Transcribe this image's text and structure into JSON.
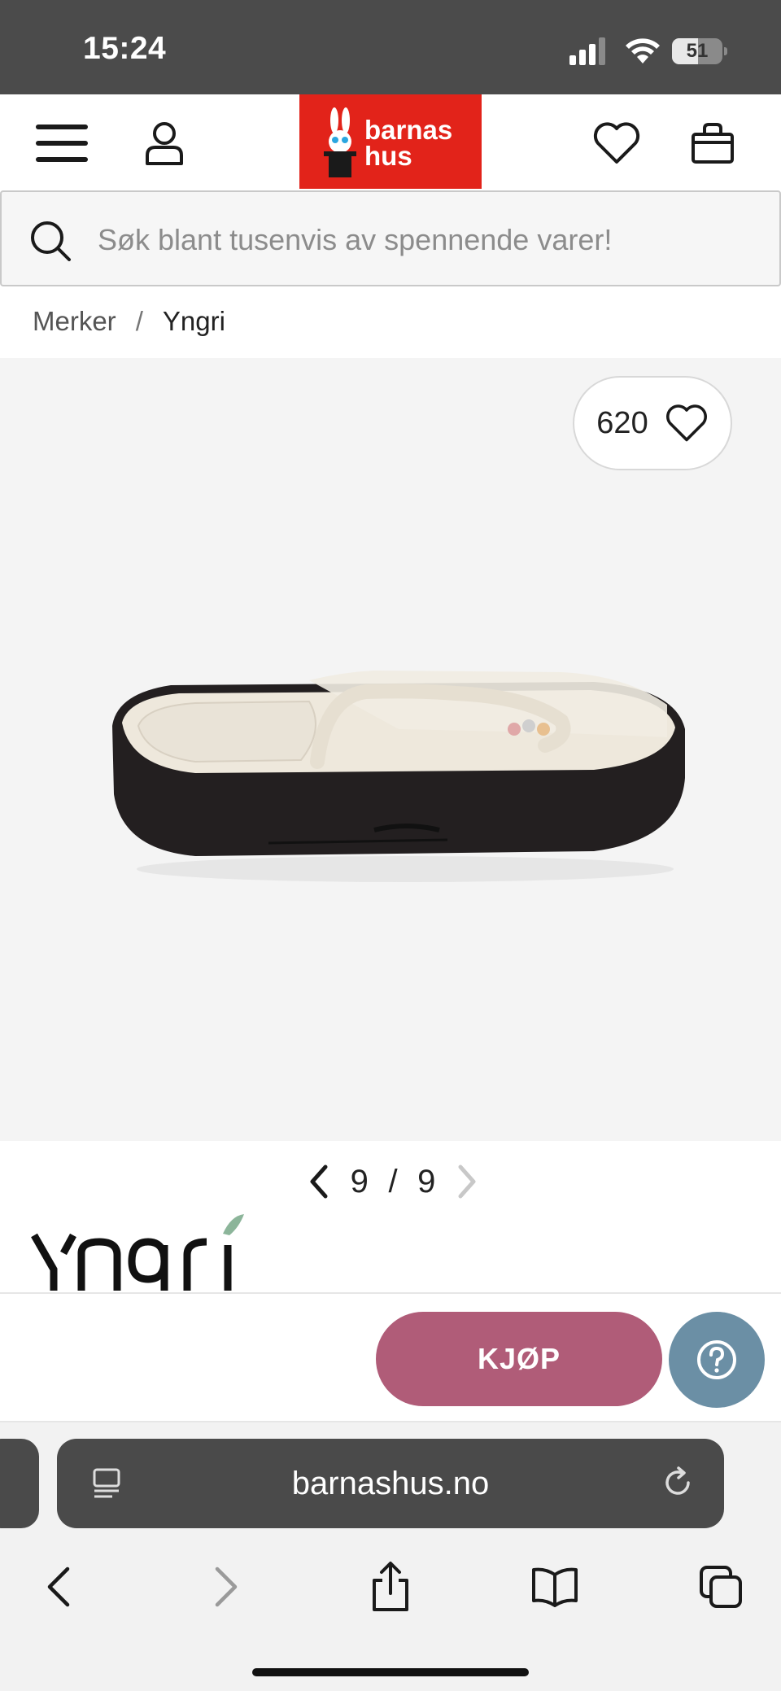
{
  "status_bar": {
    "time": "15:24",
    "battery": "51",
    "battery_level": 0.51
  },
  "header": {
    "logo_line1": "barnas",
    "logo_line2": "hus",
    "icons": [
      "menu-icon",
      "account-icon",
      "heart-icon",
      "bag-icon"
    ]
  },
  "search": {
    "placeholder": "Søk blant tusenvis av spennende varer!"
  },
  "breadcrumb": {
    "items": [
      "Merker",
      "Yngri"
    ],
    "separator": "/"
  },
  "gallery": {
    "favorites_count": "620",
    "current": "9",
    "total": "9",
    "separator": "/"
  },
  "brand": {
    "name": "Yngri"
  },
  "buy_bar": {
    "buy_label": "KJØP"
  },
  "browser": {
    "url": "barnashus.no"
  },
  "colors": {
    "brand_red": "#e2231a",
    "buy": "#b05c78",
    "help": "#6b8fa5",
    "status_bar": "#4b4b4b"
  }
}
